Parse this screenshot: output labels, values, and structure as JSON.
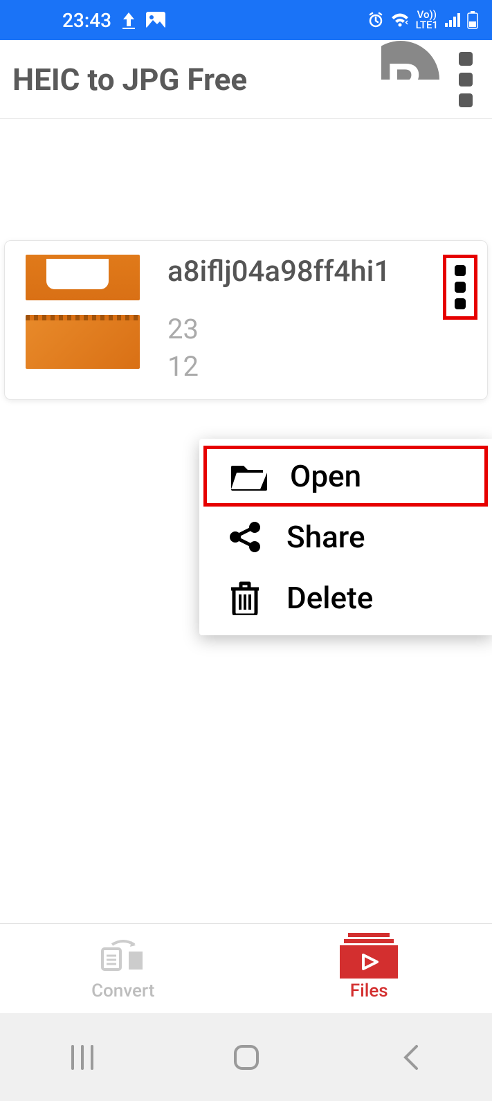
{
  "status": {
    "time": "23:43",
    "network_label": "LTE1",
    "vo_label": "Vo))"
  },
  "header": {
    "title": "HEIC to JPG Free"
  },
  "file": {
    "name": "a8iflj04a98ff4hi1",
    "meta_line1": "23",
    "meta_line2": "12"
  },
  "context_menu": {
    "open": "Open",
    "share": "Share",
    "delete": "Delete"
  },
  "tabs": {
    "convert": "Convert",
    "files": "Files"
  }
}
